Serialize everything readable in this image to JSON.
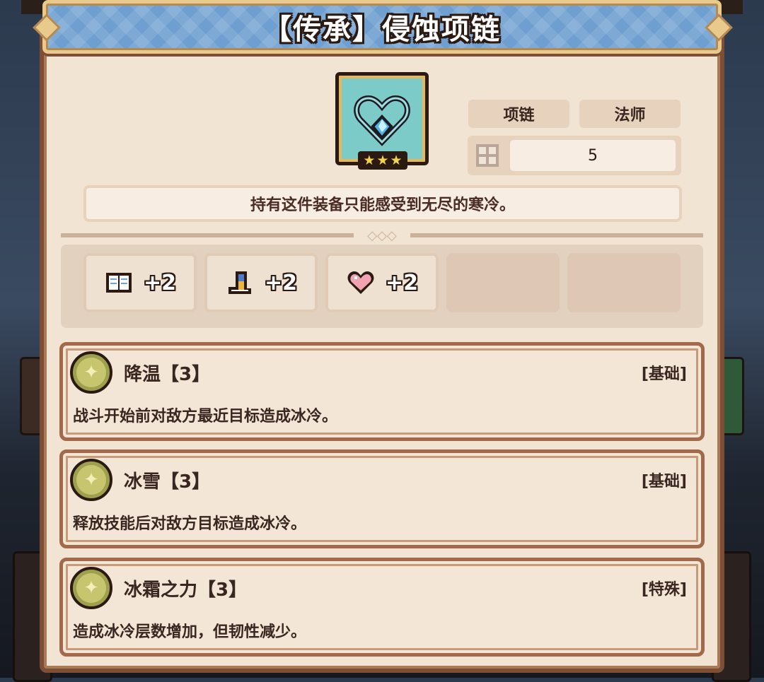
{
  "title": "【传承】侵蚀项链",
  "item": {
    "icon": "heart-necklace-icon",
    "stars": [
      "★",
      "★",
      "★"
    ],
    "tags": [
      "项链",
      "法师"
    ],
    "slot_icon": "grid-slot-icon",
    "slot_value": "5",
    "description": "持有这件装备只能感受到无尽的寒冷。"
  },
  "stats": [
    {
      "icon": "book-icon",
      "value": "+2"
    },
    {
      "icon": "boot-icon",
      "value": "+2"
    },
    {
      "icon": "heart-icon",
      "value": "+2"
    }
  ],
  "skills": [
    {
      "badge": "✦",
      "name": "降温【3】",
      "type": "[基础]",
      "desc": "战斗开始前对敌方最近目标造成冰冷。"
    },
    {
      "badge": "✦",
      "name": "冰雪【3】",
      "type": "[基础]",
      "desc": "释放技能后对敌方目标造成冰冷。"
    },
    {
      "badge": "✦",
      "name": "冰霜之力【3】",
      "type": "[特殊]",
      "desc": "造成冰冷层数增加，但韧性减少。"
    }
  ],
  "colors": {
    "panel": "#f1e4d2",
    "border": "#7d4f36",
    "title_bar": "#6f9fd0",
    "item_frame": "#7ccbc9",
    "badge": "#c7c56e"
  }
}
